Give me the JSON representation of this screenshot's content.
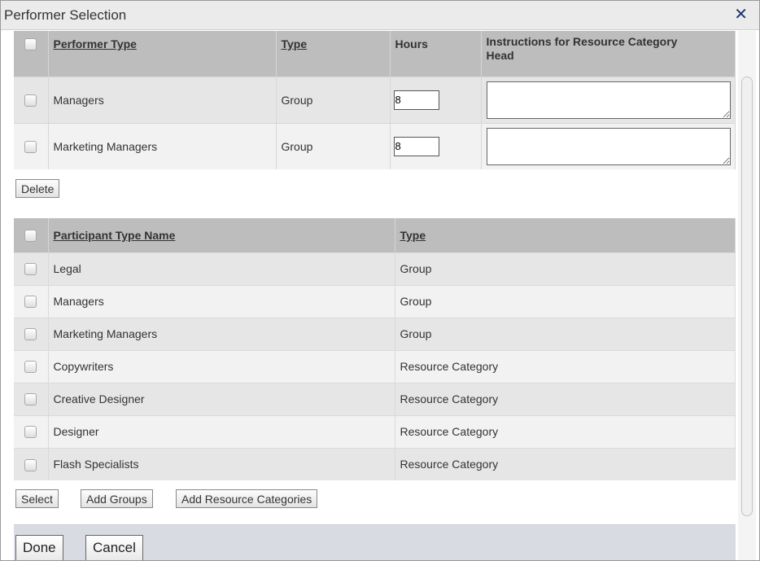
{
  "dialog": {
    "title": "Performer Selection",
    "close_glyph": "✕"
  },
  "performers": {
    "headers": {
      "performer_type": "Performer Type",
      "type": "Type",
      "hours": "Hours",
      "instructions": "Instructions for Resource Category Head"
    },
    "rows": [
      {
        "name": "Managers",
        "type": "Group",
        "hours": "8",
        "instructions": ""
      },
      {
        "name": "Marketing Managers",
        "type": "Group",
        "hours": "8",
        "instructions": ""
      }
    ],
    "delete_label": "Delete"
  },
  "participants": {
    "headers": {
      "name": "Participant Type Name",
      "type": "Type"
    },
    "rows": [
      {
        "name": "Legal",
        "type": "Group"
      },
      {
        "name": "Managers",
        "type": "Group"
      },
      {
        "name": "Marketing Managers",
        "type": "Group"
      },
      {
        "name": "Copywriters",
        "type": "Resource Category"
      },
      {
        "name": "Creative Designer",
        "type": "Resource Category"
      },
      {
        "name": "Designer",
        "type": "Resource Category"
      },
      {
        "name": "Flash Specialists",
        "type": "Resource Category"
      }
    ],
    "buttons": {
      "select": "Select",
      "add_groups": "Add Groups",
      "add_resource_categories": "Add Resource Categories"
    }
  },
  "footer": {
    "done": "Done",
    "cancel": "Cancel"
  }
}
